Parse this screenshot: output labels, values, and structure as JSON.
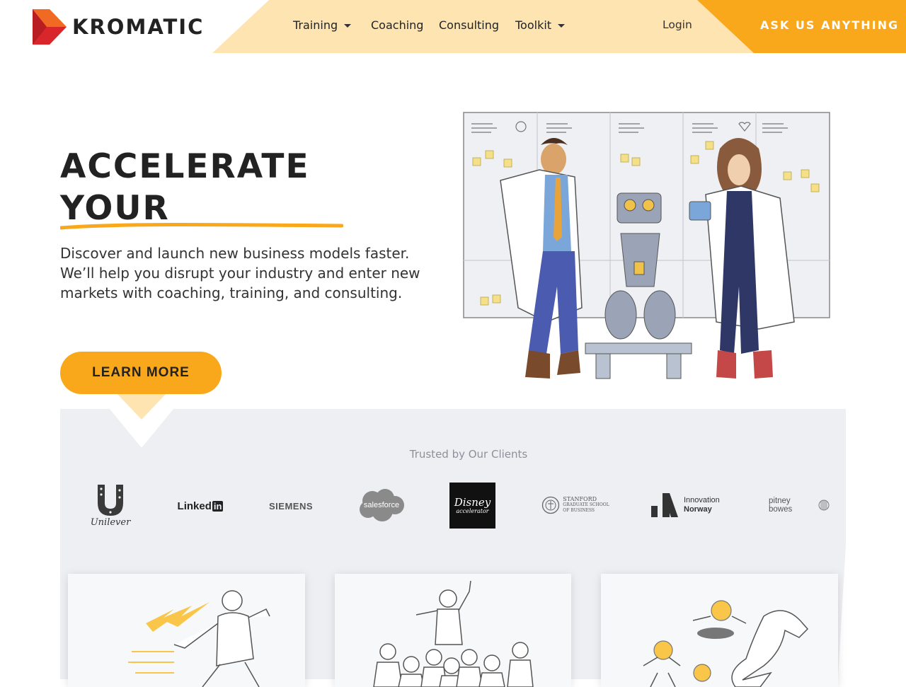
{
  "header": {
    "brand": "KROMATIC",
    "nav": [
      {
        "label": "Training",
        "dropdown": true
      },
      {
        "label": "Coaching",
        "dropdown": false
      },
      {
        "label": "Consulting",
        "dropdown": false
      },
      {
        "label": "Toolkit",
        "dropdown": true
      }
    ],
    "login": "Login",
    "cta": "ASK US ANYTHING"
  },
  "hero": {
    "title_line1": "ACCELERATE",
    "title_line2": "YOUR",
    "text": "Discover and launch new business models faster. We’ll help you disrupt your industry and enter new markets with coaching, training, and consulting.",
    "button": "LEARN MORE"
  },
  "clients": {
    "heading": "Trusted by Our Clients",
    "logos": [
      {
        "name": "Unilever"
      },
      {
        "name": "Linked",
        "suffix": "in"
      },
      {
        "name": "SIEMENS"
      },
      {
        "name": "salesforce"
      },
      {
        "name": "Disney",
        "sub": "accelerator"
      },
      {
        "name": "STANFORD",
        "line2": "GRADUATE SCHOOL",
        "line3": "OF BUSINESS"
      },
      {
        "name": "Innovation",
        "line2": "Norway"
      },
      {
        "name": "pitney bowes"
      }
    ]
  },
  "colors": {
    "accent": "#f9a81c",
    "accent_light": "#fde4b1",
    "logo_red": "#d9262b",
    "text": "#222222",
    "section_bg": "#eeeff3"
  }
}
